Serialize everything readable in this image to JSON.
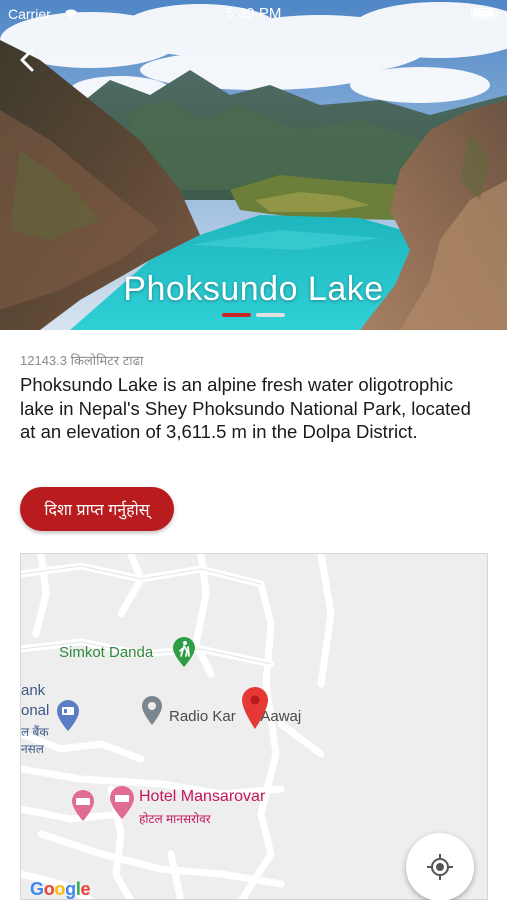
{
  "status_bar": {
    "carrier": "Carrier",
    "time": "5:39 PM"
  },
  "hero": {
    "title": "Phoksundo Lake",
    "page_count": 2,
    "active_page": 1,
    "indicator_active_color": "#c62828",
    "indicator_inactive_color": "#e0e0e0"
  },
  "place": {
    "distance": "12143.3 किलोमिटर टाढा",
    "description": "Phoksundo Lake is an alpine fresh water oligotrophic lake in Nepal's Shey Phoksundo National Park, located at an elevation of 3,611.5 m in the Dolpa District.",
    "directions_button": "दिशा प्राप्त गर्नुहोस्"
  },
  "colors": {
    "accent": "#b81c1e",
    "lake": "#27c1c9",
    "map_bg": "#eeeeee"
  },
  "map": {
    "labels": {
      "simkot": "Simkot Danda",
      "radio": "Radio Kar",
      "radio_tail": "i Aawaj",
      "bank_1": "ank",
      "bank_2": "onal",
      "bank_3": "ल बैंक",
      "bank_4": "नसल",
      "hotel_en": "Hotel Mansarovar",
      "hotel_np": "होटल मानसरोवर"
    },
    "attribution": "Google",
    "icons": [
      "hiking-icon",
      "place-pin-icon",
      "bank-icon",
      "hotel-icon",
      "red-marker-icon",
      "my-location-icon"
    ]
  }
}
